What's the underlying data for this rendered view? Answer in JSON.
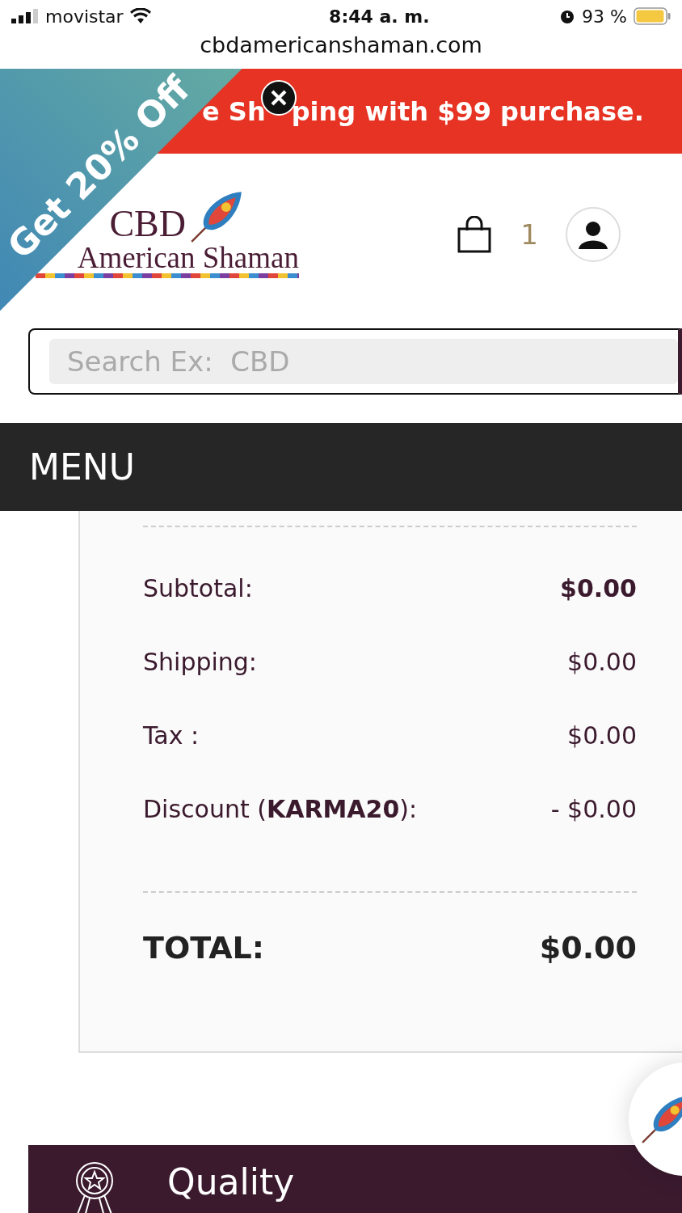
{
  "status_bar": {
    "carrier": "movistar",
    "time": "8:44 a. m.",
    "battery": "93 %"
  },
  "address_bar": {
    "url": "cbdamericanshaman.com"
  },
  "banner": {
    "text_before": "e Sh",
    "text_after": "ping with $99 purchase."
  },
  "promo_ribbon": {
    "text": "Get 20% Off"
  },
  "logo": {
    "line_1": "CBD",
    "line_2": "American Shaman"
  },
  "cart": {
    "count": "1"
  },
  "search": {
    "placeholder": "Search Ex:  CBD"
  },
  "menu": {
    "label": "MENU"
  },
  "summary": {
    "rows": [
      {
        "label": "Subtotal:",
        "value": "$0.00",
        "kind": "bold"
      },
      {
        "label": "Shipping:",
        "value": "$0.00",
        "kind": "regular"
      },
      {
        "label": "Tax :",
        "value": "$0.00",
        "kind": "regular"
      },
      {
        "label": "Discount (**KARMA20**):",
        "value": "- $0.00",
        "kind": "regular"
      }
    ],
    "total": {
      "label": "TOTAL:",
      "value": "$0.00"
    }
  },
  "feature": {
    "label": "Quality"
  }
}
